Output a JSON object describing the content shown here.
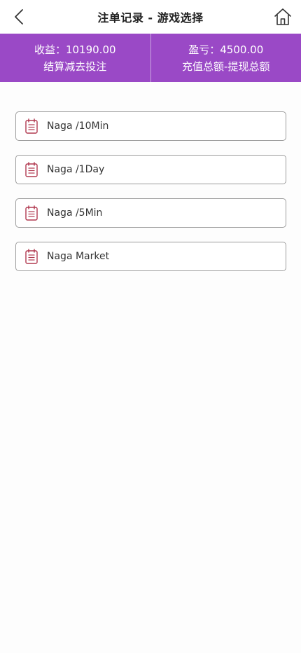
{
  "header": {
    "title": "注单记录 - 游戏选择",
    "back_icon": "chevron-left-icon",
    "home_icon": "home-icon"
  },
  "stats": {
    "income_line": "收益：10190.00",
    "income_desc": "结算减去投注",
    "profit_line": "盈亏：4500.00",
    "profit_desc": "充值总额-提现总额",
    "bg_color": "#9a49c6"
  },
  "games": [
    {
      "label": "Naga /10Min",
      "icon": "document-list-icon"
    },
    {
      "label": "Naga /1Day",
      "icon": "document-list-icon"
    },
    {
      "label": "Naga /5Min",
      "icon": "document-list-icon"
    },
    {
      "label": "Naga Market",
      "icon": "document-list-icon"
    }
  ]
}
